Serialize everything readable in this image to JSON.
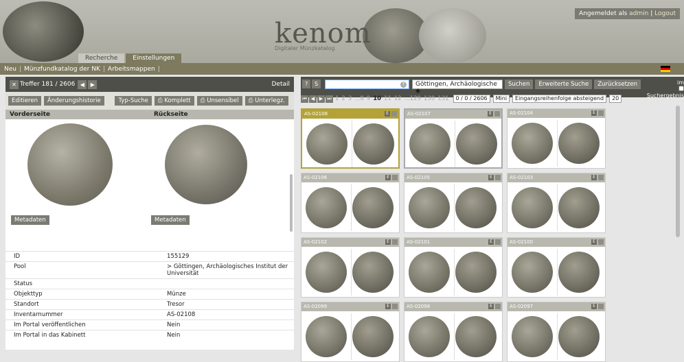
{
  "login": {
    "prefix": "Angemeldet als",
    "user": "admin",
    "sep": "|",
    "logout": "Logout"
  },
  "header": {
    "logo_main": "kenom",
    "logo_sub": "Digitaler Münzkatalog"
  },
  "tabs": [
    {
      "label": "Recherche"
    },
    {
      "label": "Einstellungen"
    }
  ],
  "menubar": {
    "items": [
      {
        "label": "Neu"
      },
      {
        "label": "Münzfundkatalog der NK"
      },
      {
        "label": "Arbeitsmappen"
      }
    ],
    "sep": "|"
  },
  "left": {
    "hits": "Treffer 181 / 2606",
    "detail": "Detail",
    "buttons": {
      "edit": "Editieren",
      "history": "Änderungshistorie",
      "type_search": "Typ-Suche",
      "complete": "Komplett",
      "unsensible": "Unsensibel",
      "underlay": "Unterlegz."
    },
    "sides": {
      "front": "Vorderseite",
      "back": "Rückseite"
    },
    "meta_label": "Metadaten",
    "props": [
      {
        "k": "ID",
        "v": "155129"
      },
      {
        "k": "Pool",
        "v": "> Göttingen, Archäologisches Institut der Universität"
      },
      {
        "k": "Status",
        "v": ""
      },
      {
        "k": "Objekttyp",
        "v": "Münze"
      },
      {
        "k": "Standort",
        "v": "Tresor"
      },
      {
        "k": "Inventarnummer",
        "v": "AS-02108"
      },
      {
        "k": "Im Portal veröffentlichen",
        "v": "Nein"
      },
      {
        "k": "Im Portal in das Kabinett",
        "v": "Nein"
      }
    ]
  },
  "right": {
    "search_value": "",
    "pool_select": "Göttingen, Archäologische ◆",
    "search_btn": "Suchen",
    "advanced_btn": "Erweiterte Suche",
    "reset_btn": "Zurücksetzen",
    "im_label": "im",
    "im_check": "Suchergebnis",
    "pages": [
      "1",
      "2",
      "3",
      "...8",
      "9",
      "10",
      "11",
      "12",
      "...129",
      "130",
      "131"
    ],
    "current_page": "10",
    "count_select": "0 / 0 / 2606",
    "size_select": "Mini",
    "order_select": "Eingangsreihenfolge absteigend",
    "per_page": "20",
    "cards": [
      {
        "id": "AS-02108",
        "state": "selected"
      },
      {
        "id": "AS-02107",
        "state": "viewed"
      },
      {
        "id": "AS-02104",
        "state": ""
      },
      {
        "id": "AS-02106",
        "state": ""
      },
      {
        "id": "AS-02105",
        "state": ""
      },
      {
        "id": "AS-02103",
        "state": ""
      },
      {
        "id": "AS-02102",
        "state": ""
      },
      {
        "id": "AS-02101",
        "state": ""
      },
      {
        "id": "AS-02100",
        "state": ""
      },
      {
        "id": "AS-02099",
        "state": ""
      },
      {
        "id": "AS-02098",
        "state": ""
      },
      {
        "id": "AS-02097",
        "state": ""
      }
    ],
    "card_badge": "E"
  }
}
